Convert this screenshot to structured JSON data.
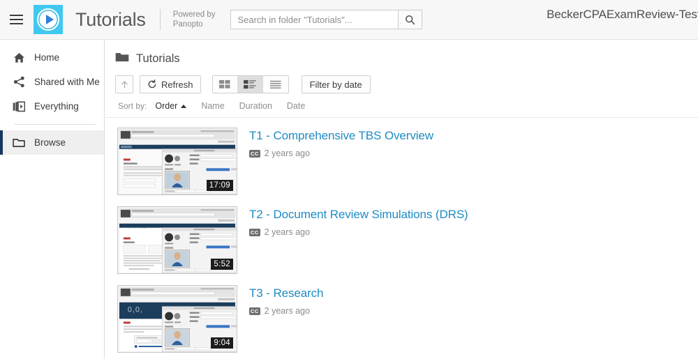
{
  "header": {
    "menu_icon": "hamburger-icon",
    "logo_icon": "panopto-play-logo",
    "site_title": "Tutorials",
    "powered_line1": "Powered by",
    "powered_line2": "Panopto",
    "search_placeholder": "Search in folder \"Tutorials\"...",
    "search_value": "",
    "search_icon": "search-icon",
    "org_name": "BeckerCPAExamReview-Test\\"
  },
  "sidebar": {
    "items": [
      {
        "label": "Home",
        "icon": "home-icon",
        "selected": false
      },
      {
        "label": "Shared with Me",
        "icon": "share-icon",
        "selected": false
      },
      {
        "label": "Everything",
        "icon": "video-stack-icon",
        "selected": false
      },
      {
        "label": "Browse",
        "icon": "folder-icon",
        "selected": true
      }
    ],
    "selected_accent": "#17375e"
  },
  "content": {
    "folder_icon": "folder-icon",
    "folder_name": "Tutorials",
    "toolbar": {
      "up_icon": "arrow-up-icon",
      "refresh_icon": "refresh-icon",
      "refresh_label": "Refresh",
      "view_modes": [
        {
          "name": "grid-view",
          "active": false
        },
        {
          "name": "thumbnail-list-view",
          "active": true
        },
        {
          "name": "compact-list-view",
          "active": false
        }
      ],
      "filter_label": "Filter by date"
    },
    "sort": {
      "label": "Sort by:",
      "options": [
        {
          "label": "Order",
          "active": true,
          "caret": "caret-up-icon"
        },
        {
          "label": "Name",
          "active": false
        },
        {
          "label": "Duration",
          "active": false
        },
        {
          "label": "Date",
          "active": false
        }
      ]
    },
    "videos": [
      {
        "title": "T1 - Comprehensive TBS Overview",
        "duration": "17:09",
        "age": "2 years ago",
        "cc": "CC"
      },
      {
        "title": "T2 - Document Review Simulations (DRS)",
        "duration": "5:52",
        "age": "2 years ago",
        "cc": "CC"
      },
      {
        "title": "T3 - Research",
        "duration": "9:04",
        "age": "2 years ago",
        "cc": "CC"
      }
    ]
  },
  "colors": {
    "link": "#1e8bc3",
    "logo_bg": "#3fc9f0",
    "header_bg": "#f7f7f7",
    "selected_nav_bg": "#efefef"
  }
}
